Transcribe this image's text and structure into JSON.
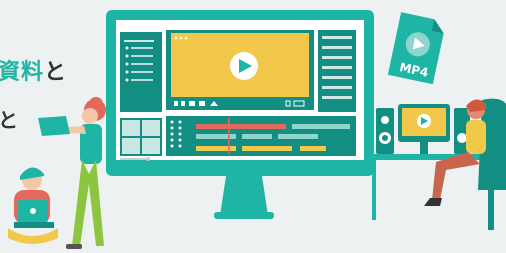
{
  "heading": {
    "line1_accent": "資料",
    "line1_rest": "と",
    "line2_fragment": "と"
  },
  "file_icon": {
    "label": "MP4",
    "icon": "video-file-icon"
  },
  "colors": {
    "teal": "#1fb5a4",
    "teal_dark": "#138e82",
    "screen_yellow": "#f2c84b",
    "background": "#eef1f2"
  },
  "editor": {
    "icons": [
      "play-icon",
      "timeline-icon",
      "playback-controls-icon"
    ]
  }
}
